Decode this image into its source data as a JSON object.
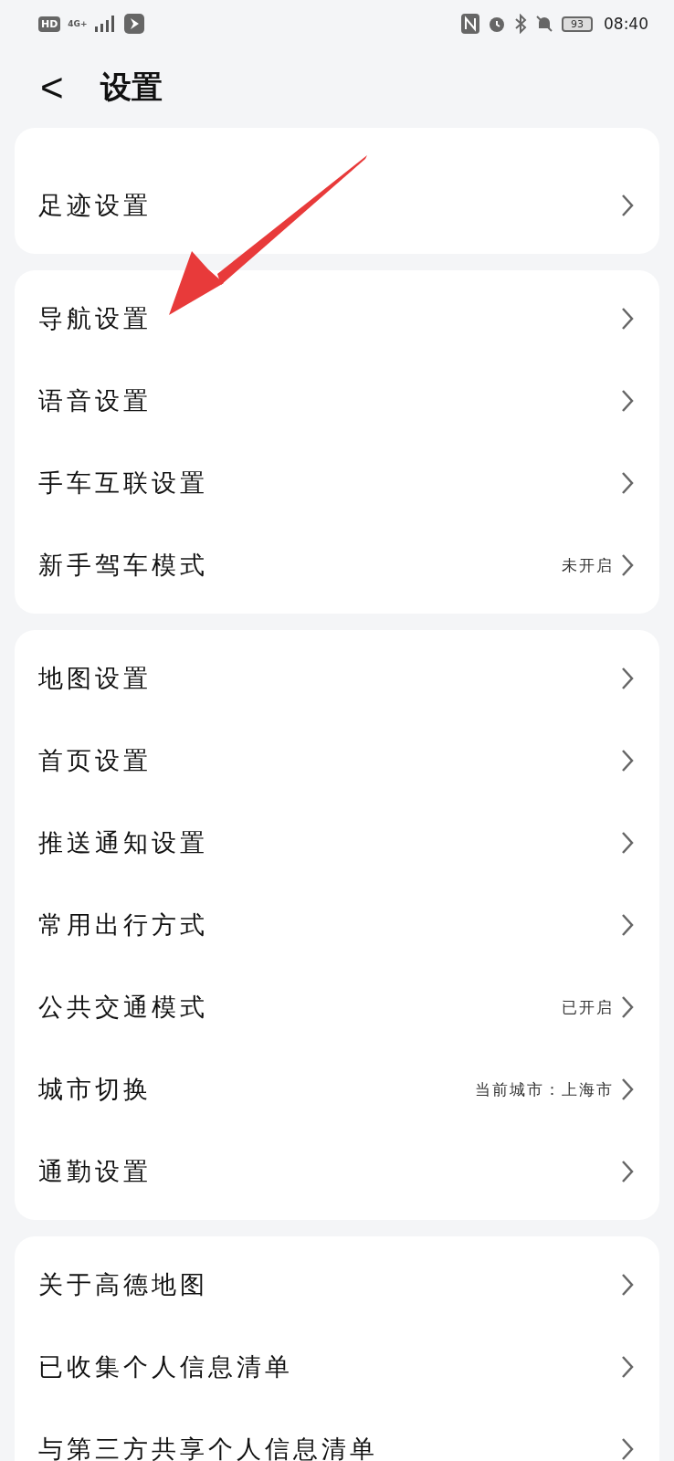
{
  "status_bar": {
    "hd": "HD",
    "network": "4G+",
    "battery": "93",
    "time": "08:40"
  },
  "header": {
    "back": "<",
    "title": "设置"
  },
  "groups": [
    {
      "items": [
        {
          "label": "足迹设置"
        }
      ]
    },
    {
      "items": [
        {
          "label": "导航设置"
        },
        {
          "label": "语音设置"
        },
        {
          "label": "手车互联设置"
        },
        {
          "label": "新手驾车模式",
          "value": "未开启"
        }
      ]
    },
    {
      "items": [
        {
          "label": "地图设置"
        },
        {
          "label": "首页设置"
        },
        {
          "label": "推送通知设置"
        },
        {
          "label": "常用出行方式"
        },
        {
          "label": "公共交通模式",
          "value": "已开启"
        },
        {
          "label": "城市切换",
          "value": "当前城市：上海市"
        },
        {
          "label": "通勤设置"
        }
      ]
    },
    {
      "items": [
        {
          "label": "关于高德地图"
        },
        {
          "label": "已收集个人信息清单"
        },
        {
          "label": "与第三方共享个人信息清单"
        }
      ]
    }
  ]
}
